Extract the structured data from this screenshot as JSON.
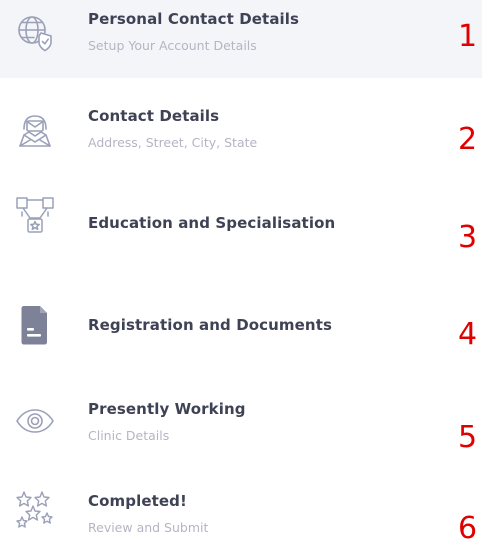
{
  "steps": [
    {
      "title": "Personal Contact Details",
      "description": "Setup Your Account Details",
      "number": "1",
      "icon": "globe-shield-icon",
      "active": true
    },
    {
      "title": "Contact Details",
      "description": "Address, Street, City, State",
      "number": "2",
      "icon": "person-mail-icon"
    },
    {
      "title": "Education and Specialisation",
      "description": "",
      "number": "3",
      "icon": "award-medal-icon"
    },
    {
      "title": "Registration and Documents",
      "description": "",
      "number": "4",
      "icon": "document-icon"
    },
    {
      "title": "Presently Working",
      "description": "Clinic Details",
      "number": "5",
      "icon": "eye-icon"
    },
    {
      "title": "Completed!",
      "description": "Review and Submit",
      "number": "6",
      "icon": "sparkle-stars-icon"
    }
  ],
  "colors": {
    "active_background": "#f4f5f9",
    "title": "#3f4254",
    "description": "#b5b5c3",
    "icon_stroke": "#a1a5b7",
    "icon_fill": "#7e8299",
    "annotation_number": "#e10000"
  }
}
